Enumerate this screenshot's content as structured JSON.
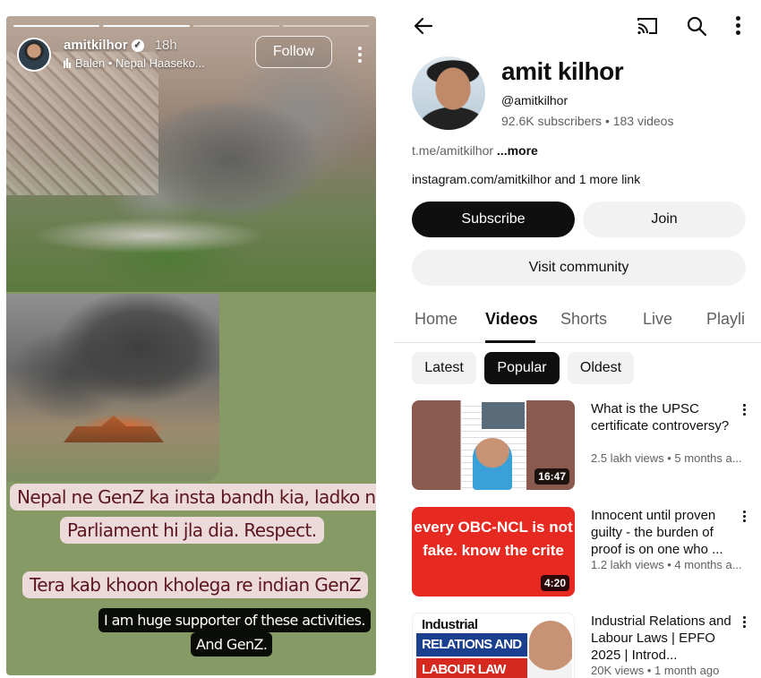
{
  "story": {
    "username": "amitkilhor",
    "time": "18h",
    "music": "Balen • Nepal Haaseko...",
    "follow_label": "Follow",
    "captions": {
      "line1": "Nepal ne GenZ ka insta bandh kia, ladko ne",
      "line2": "Parliament hi jla dia. Respect.",
      "line3": "Tera kab khoon kholega re indian GenZ",
      "line4a": "I am huge supporter of these activities.",
      "line4b": "And GenZ."
    }
  },
  "channel": {
    "name": "amit kilhor",
    "handle": "@amitkilhor",
    "stats": "92.6K subscribers • 183 videos",
    "desc_link": "t.me/amitkilhor",
    "desc_more": "...more",
    "links": "instagram.com/amitkilhor and 1 more link",
    "subscribe_label": "Subscribe",
    "join_label": "Join",
    "community_label": "Visit community"
  },
  "tabs": [
    "Home",
    "Videos",
    "Shorts",
    "Live",
    "Playli"
  ],
  "chips": [
    "Latest",
    "Popular",
    "Oldest"
  ],
  "videos": [
    {
      "title": "What is the UPSC certificate controversy?",
      "meta": "2.5 lakh views • 5 months a...",
      "duration": "16:47"
    },
    {
      "title": "Innocent until proven guilty - the burden of proof is on one who ...",
      "meta": "1.2 lakh views • 4 months a...",
      "duration": "4:20",
      "thumb_text": "every OBC-NCL is not fake. know the crite"
    },
    {
      "title": "Industrial Relations and Labour Laws | EPFO 2025 | Introd...",
      "meta": "20K views • 1 month ago",
      "thumb_line1": "Industrial",
      "thumb_line2": "RELATIONS AND",
      "thumb_line3": "LABOUR LAW"
    }
  ]
}
